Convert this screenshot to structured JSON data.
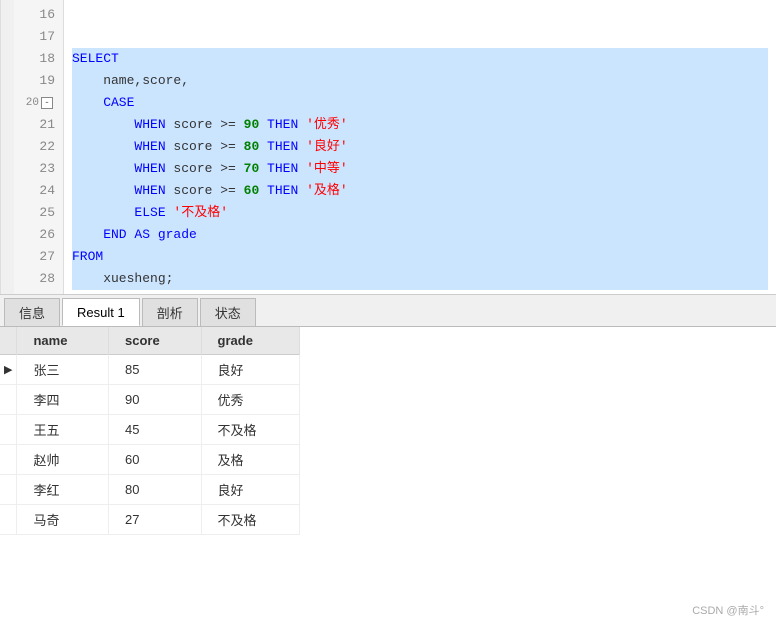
{
  "editor": {
    "lines": [
      {
        "num": "16",
        "content": "",
        "highlighted": false,
        "parts": []
      },
      {
        "num": "17",
        "content": "",
        "highlighted": false,
        "parts": []
      },
      {
        "num": "18",
        "content": "SELECT",
        "highlighted": true,
        "parts": [
          {
            "text": "SELECT",
            "cls": "kw-blue"
          }
        ]
      },
      {
        "num": "19",
        "content": "    name,score,",
        "highlighted": true,
        "parts": [
          {
            "text": "    name,score,",
            "cls": "normal"
          }
        ]
      },
      {
        "num": "20",
        "content": "    CASE",
        "highlighted": true,
        "fold": true,
        "parts": [
          {
            "text": "    CASE",
            "cls": "kw-blue"
          }
        ]
      },
      {
        "num": "21",
        "content": "        WHEN score >= 90 THEN '优秀'",
        "highlighted": true,
        "parts": [
          {
            "text": "        WHEN ",
            "cls": "kw-blue"
          },
          {
            "text": "score >= ",
            "cls": "normal"
          },
          {
            "text": "90",
            "cls": "num-green"
          },
          {
            "text": " THEN ",
            "cls": "kw-blue"
          },
          {
            "text": "'优秀'",
            "cls": "str-red"
          }
        ]
      },
      {
        "num": "22",
        "content": "        WHEN score >= 80 THEN '良好'",
        "highlighted": true,
        "parts": [
          {
            "text": "        WHEN ",
            "cls": "kw-blue"
          },
          {
            "text": "score >= ",
            "cls": "normal"
          },
          {
            "text": "80",
            "cls": "num-green"
          },
          {
            "text": " THEN ",
            "cls": "kw-blue"
          },
          {
            "text": "'良好'",
            "cls": "str-red"
          }
        ]
      },
      {
        "num": "23",
        "content": "        WHEN score >= 70 THEN '中等'",
        "highlighted": true,
        "parts": [
          {
            "text": "        WHEN ",
            "cls": "kw-blue"
          },
          {
            "text": "score >= ",
            "cls": "normal"
          },
          {
            "text": "70",
            "cls": "num-green"
          },
          {
            "text": " THEN ",
            "cls": "kw-blue"
          },
          {
            "text": "'中等'",
            "cls": "str-red"
          }
        ]
      },
      {
        "num": "24",
        "content": "        WHEN score >= 60 THEN '及格'",
        "highlighted": true,
        "parts": [
          {
            "text": "        WHEN ",
            "cls": "kw-blue"
          },
          {
            "text": "score >= ",
            "cls": "normal"
          },
          {
            "text": "60",
            "cls": "num-green"
          },
          {
            "text": " THEN ",
            "cls": "kw-blue"
          },
          {
            "text": "'及格'",
            "cls": "str-red"
          }
        ]
      },
      {
        "num": "25",
        "content": "        ELSE '不及格'",
        "highlighted": true,
        "parts": [
          {
            "text": "        ELSE ",
            "cls": "kw-blue"
          },
          {
            "text": "'不及格'",
            "cls": "str-red"
          }
        ]
      },
      {
        "num": "26",
        "content": "    END AS grade",
        "highlighted": true,
        "parts": [
          {
            "text": "    END AS grade",
            "cls": "kw-blue"
          }
        ]
      },
      {
        "num": "27",
        "content": "FROM",
        "highlighted": true,
        "parts": [
          {
            "text": "FROM",
            "cls": "kw-blue"
          }
        ]
      },
      {
        "num": "28",
        "content": "    xuesheng;",
        "highlighted": true,
        "parts": [
          {
            "text": "    xuesheng;",
            "cls": "normal"
          }
        ]
      }
    ]
  },
  "tabs": [
    {
      "id": "info",
      "label": "信息",
      "active": false
    },
    {
      "id": "result1",
      "label": "Result 1",
      "active": true
    },
    {
      "id": "parse",
      "label": "剖析",
      "active": false
    },
    {
      "id": "status",
      "label": "状态",
      "active": false
    }
  ],
  "table": {
    "columns": [
      "name",
      "score",
      "grade"
    ],
    "rows": [
      {
        "indicator": "▶",
        "name": "张三",
        "score": "85",
        "grade": "良好"
      },
      {
        "indicator": "",
        "name": "李四",
        "score": "90",
        "grade": "优秀"
      },
      {
        "indicator": "",
        "name": "王五",
        "score": "45",
        "grade": "不及格"
      },
      {
        "indicator": "",
        "name": "赵帅",
        "score": "60",
        "grade": "及格"
      },
      {
        "indicator": "",
        "name": "李红",
        "score": "80",
        "grade": "良好"
      },
      {
        "indicator": "",
        "name": "马奇",
        "score": "27",
        "grade": "不及格"
      }
    ]
  },
  "watermark": "CSDN @南斗°"
}
